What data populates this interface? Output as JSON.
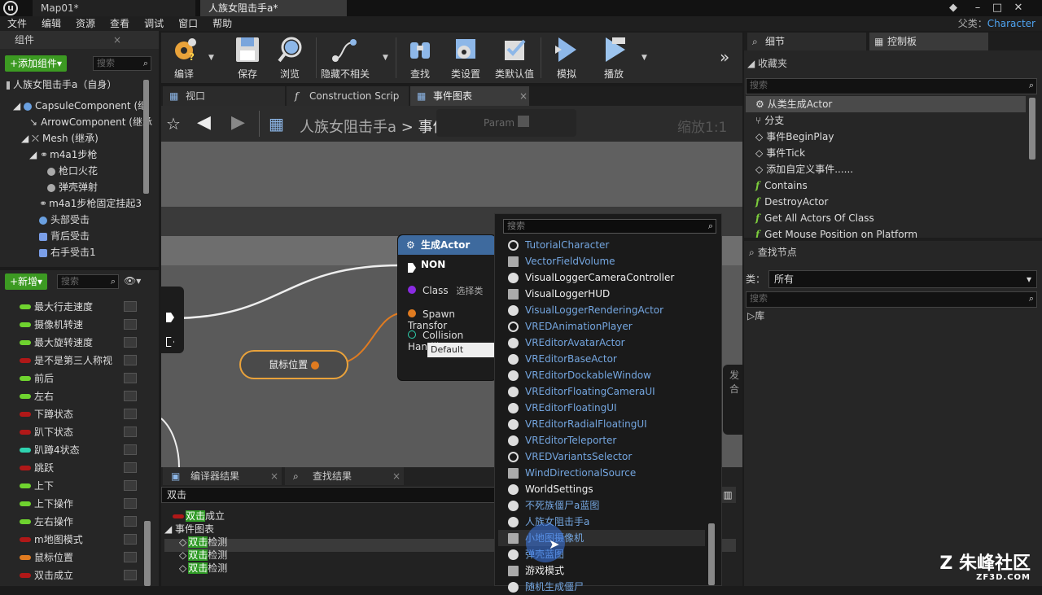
{
  "window": {
    "tabs": [
      "Map01*",
      "人族女阻击手a*"
    ],
    "parent_label": "父类：",
    "parent_value": "Character"
  },
  "menu": [
    "文件",
    "编辑",
    "资源",
    "查看",
    "调试",
    "窗口",
    "帮助"
  ],
  "components": {
    "title": "组件",
    "add_button": "+添加组件▾",
    "search_placeholder": "搜索",
    "items": [
      "人族女阻击手a（自身）",
      "CapsuleComponent (继",
      "ArrowComponent (继承",
      "Mesh (继承)",
      "m4a1步枪",
      "枪口火花",
      "弹壳弹射",
      "m4a1步枪固定挂起3",
      "头部受击",
      "背后受击",
      "右手受击1"
    ]
  },
  "my_blueprint": {
    "new_button": "+新增▾",
    "search_placeholder": "搜索",
    "variables": [
      {
        "name": "最大行走速度",
        "color": "#6fd32f"
      },
      {
        "name": "摄像机转速",
        "color": "#6fd32f"
      },
      {
        "name": "最大旋转速度",
        "color": "#6fd32f"
      },
      {
        "name": "是不是第三人称视",
        "color": "#b01818"
      },
      {
        "name": "前后",
        "color": "#6fd32f"
      },
      {
        "name": "左右",
        "color": "#6fd32f"
      },
      {
        "name": "下蹲状态",
        "color": "#b01818"
      },
      {
        "name": "趴下状态",
        "color": "#b01818"
      },
      {
        "name": "趴蹲4状态",
        "color": "#2fd3b0"
      },
      {
        "name": "跳跃",
        "color": "#b01818"
      },
      {
        "name": "上下",
        "color": "#6fd32f"
      },
      {
        "name": "上下操作",
        "color": "#6fd32f"
      },
      {
        "name": "左右操作",
        "color": "#6fd32f"
      },
      {
        "name": "m地图模式",
        "color": "#b01818"
      },
      {
        "name": "鼠标位置",
        "color": "#e07b20"
      },
      {
        "name": "双击成立",
        "color": "#b01818"
      }
    ]
  },
  "toolbar": {
    "buttons": [
      "编译",
      "保存",
      "浏览",
      "隐藏不相关",
      "查找",
      "类设置",
      "类默认值",
      "模拟",
      "播放"
    ]
  },
  "graph_tabs": [
    "视口",
    "Construction Scrip",
    "事件图表"
  ],
  "breadcrumb": {
    "root": "人族女阻击手a",
    "sep": ">",
    "current": "事件图表"
  },
  "graph": {
    "zoom": "缩放1:1",
    "faded_param": "Param",
    "node_title": "生成Actor NON",
    "pin_class": "Class",
    "pin_class_value": "选择类",
    "pin_spawn": "Spawn Transfor",
    "pin_collision": "Collision Handlin",
    "collision_value": "Default",
    "var_node": "鼠标位置",
    "right_node_text": "发\n合"
  },
  "context_menu": {
    "search_placeholder": "搜索",
    "items": [
      {
        "label": "TutorialCharacter",
        "blue": true,
        "icon": "ring"
      },
      {
        "label": "VectorFieldVolume",
        "blue": true,
        "icon": "sq"
      },
      {
        "label": "VisualLoggerCameraController",
        "blue": false,
        "icon": "dot"
      },
      {
        "label": "VisualLoggerHUD",
        "blue": false,
        "icon": "sq"
      },
      {
        "label": "VisualLoggerRenderingActor",
        "blue": true,
        "icon": "dot"
      },
      {
        "label": "VREDAnimationPlayer",
        "blue": true,
        "icon": "ring"
      },
      {
        "label": "VREditorAvatarActor",
        "blue": true,
        "icon": "dot"
      },
      {
        "label": "VREditorBaseActor",
        "blue": true,
        "icon": "dot"
      },
      {
        "label": "VREditorDockableWindow",
        "blue": true,
        "icon": "dot"
      },
      {
        "label": "VREditorFloatingCameraUI",
        "blue": true,
        "icon": "dot"
      },
      {
        "label": "VREditorFloatingUI",
        "blue": true,
        "icon": "dot"
      },
      {
        "label": "VREditorRadialFloatingUI",
        "blue": true,
        "icon": "dot"
      },
      {
        "label": "VREditorTeleporter",
        "blue": true,
        "icon": "dot"
      },
      {
        "label": "VREDVariantsSelector",
        "blue": true,
        "icon": "ring"
      },
      {
        "label": "WindDirectionalSource",
        "blue": true,
        "icon": "sq"
      },
      {
        "label": "WorldSettings",
        "blue": false,
        "icon": "dot"
      },
      {
        "label": "不死族僵尸a蓝图",
        "blue": true,
        "icon": "dot"
      },
      {
        "label": "人族女阻击手a",
        "blue": true,
        "icon": "dot"
      },
      {
        "label": "小地图摄像机",
        "blue": true,
        "icon": "sq"
      },
      {
        "label": "弹壳蓝图",
        "blue": true,
        "icon": "dot"
      },
      {
        "label": "游戏模式",
        "blue": false,
        "icon": "sq"
      },
      {
        "label": "随机生成僵尸",
        "blue": true,
        "icon": "dot"
      }
    ]
  },
  "bottom": {
    "tabs": [
      "编译器结果",
      "查找结果"
    ],
    "search_value": "双击",
    "results": [
      {
        "hl": "双击",
        "rest": "成立",
        "indent": 1
      },
      {
        "hl": "",
        "rest": "事件图表",
        "indent": 0
      },
      {
        "hl": "双击",
        "rest": "检测",
        "indent": 1
      },
      {
        "hl": "双击",
        "rest": "检测",
        "indent": 1
      },
      {
        "hl": "双击",
        "rest": "检测",
        "indent": 1
      }
    ]
  },
  "right_panel": {
    "tabs": [
      "细节",
      "控制板"
    ],
    "favorites_title": "收藏夹",
    "search_placeholder": "搜索",
    "favorites": [
      {
        "label": "从类生成Actor",
        "icon": "gear"
      },
      {
        "label": "分支",
        "icon": "branch"
      },
      {
        "label": "事件BeginPlay",
        "icon": "event"
      },
      {
        "label": "事件Tick",
        "icon": "event"
      },
      {
        "label": "添加自定义事件......",
        "icon": "event"
      },
      {
        "label": "Contains",
        "icon": "f"
      },
      {
        "label": "DestroyActor",
        "icon": "f"
      },
      {
        "label": "Get All Actors Of Class",
        "icon": "f"
      },
      {
        "label": "Get Mouse Position on Platform",
        "icon": "f"
      }
    ],
    "find_node_title": "查找节点",
    "category_label": "类：",
    "category_value": "所有",
    "library_label": "库"
  },
  "watermark": {
    "main": "朱峰社区",
    "sub": "ZF3D.COM"
  }
}
